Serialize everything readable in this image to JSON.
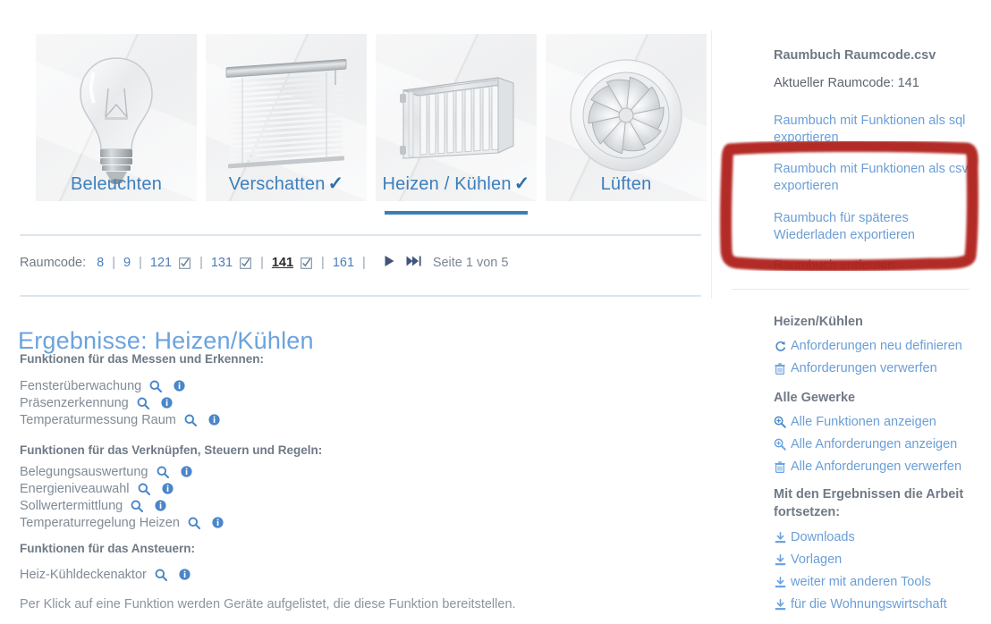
{
  "cards": [
    {
      "label": "Beleuchten",
      "icon": "lightbulb-image",
      "checked": false,
      "active": false,
      "check_mark": "✓"
    },
    {
      "label": "Verschatten",
      "icon": "window-blind-image",
      "checked": true,
      "active": false,
      "check_mark": "✓"
    },
    {
      "label": "Heizen / Kühlen",
      "icon": "radiator-image",
      "checked": true,
      "active": true,
      "check_mark": "✓"
    },
    {
      "label": "Lüften",
      "icon": "air-diffuser-image",
      "checked": false,
      "active": false,
      "check_mark": "✓"
    }
  ],
  "pagination": {
    "label": "Raumcode:",
    "separator": "|",
    "codes": [
      {
        "code": "8",
        "checked": false,
        "current": false
      },
      {
        "code": "9",
        "checked": false,
        "current": false
      },
      {
        "code": "121",
        "checked": true,
        "current": false
      },
      {
        "code": "131",
        "checked": true,
        "current": false
      },
      {
        "code": "141",
        "checked": true,
        "current": true
      },
      {
        "code": "161",
        "checked": false,
        "current": false
      }
    ],
    "next_icon": "play-next-icon",
    "last_icon": "skip-to-last-icon",
    "page_status": "Seite 1 von 5"
  },
  "results": {
    "title": "Ergebnisse: Heizen/Kühlen",
    "groups": [
      {
        "heading": "Funktionen für das Messen und Erkennen:",
        "functions": [
          {
            "name": "Fensterüberwachung"
          },
          {
            "name": "Präsenzerkennung"
          },
          {
            "name": "Temperaturmessung Raum"
          }
        ]
      },
      {
        "heading": "Funktionen für das Verknüpfen, Steuern und Regeln:",
        "functions": [
          {
            "name": "Belegungsauswertung"
          },
          {
            "name": "Energieniveauwahl"
          },
          {
            "name": "Sollwertermittlung"
          },
          {
            "name": "Temperaturregelung Heizen"
          }
        ]
      },
      {
        "heading": "Funktionen für das Ansteuern:",
        "functions": [
          {
            "name": "Heiz-Kühldeckenaktor"
          }
        ]
      }
    ],
    "footnote": "Per Klick auf eine Funktion werden Geräte aufgelistet, die diese Funktion bereitstellen."
  },
  "sidebar": {
    "raumbuch_title": "Raumbuch Raumcode.csv",
    "current_code_label": "Aktueller Raumcode: 141",
    "export_links": [
      "Raumbuch mit Funktionen als sql exportieren",
      "Raumbuch mit Funktionen als csv exportieren",
      "Raumbuch für späteres Wiederladen exportieren",
      "Raumbuch entfernen"
    ],
    "section_gewerk": {
      "heading": "Heizen/Kühlen",
      "items": [
        {
          "label": "Anforderungen neu definieren",
          "icon": "refresh-icon"
        },
        {
          "label": "Anforderungen verwerfen",
          "icon": "trash-icon"
        }
      ]
    },
    "section_alle": {
      "heading": "Alle Gewerke",
      "items": [
        {
          "label": "Alle Funktionen anzeigen",
          "icon": "search-plus-icon"
        },
        {
          "label": "Alle Anforderungen anzeigen",
          "icon": "search-plus-icon"
        },
        {
          "label": "Alle Anforderungen verwerfen",
          "icon": "trash-icon"
        }
      ]
    },
    "section_weiter": {
      "heading": "Mit den Ergebnissen die Arbeit fortsetzen:",
      "items": [
        {
          "label": "Downloads",
          "icon": "download-icon"
        },
        {
          "label": "Vorlagen",
          "icon": "download-icon"
        },
        {
          "label": "weiter mit anderen Tools",
          "icon": "download-icon"
        },
        {
          "label": "für die Wohnungswirtschaft",
          "icon": "download-icon"
        }
      ]
    }
  },
  "annotation": {
    "shape": "red-rectangle-highlight",
    "color": "#ae1f16"
  },
  "colors": {
    "link_blue": "#6b9ed6",
    "title_blue": "#6ba3dd",
    "card_label_blue": "#3c7fbd",
    "active_underline": "#3a7fb5",
    "body_gray": "#808b96",
    "heading_gray": "#6f7a86",
    "annotation_red": "#ae1f16"
  }
}
